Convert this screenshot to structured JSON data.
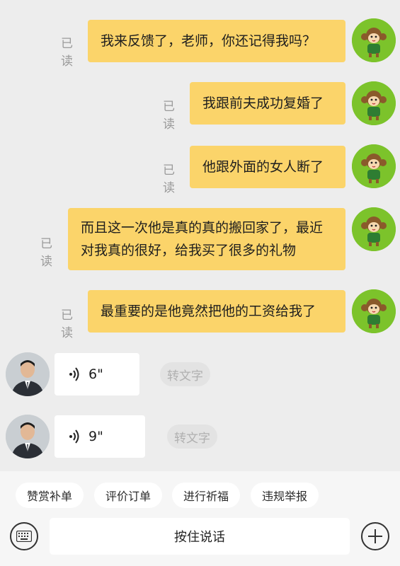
{
  "messages_out": [
    {
      "read": "已读",
      "text": "我来反馈了，老师，你还记得我吗？"
    },
    {
      "read": "已读",
      "text": "我跟前夫成功复婚了"
    },
    {
      "read": "已读",
      "text": "他跟外面的女人断了"
    },
    {
      "read": "已读",
      "text": "而且这一次他是真的真的搬回家了，最近对我真的很好，给我买了很多的礼物"
    },
    {
      "read": "已读",
      "text": "最重要的是他竟然把他的工资给我了"
    }
  ],
  "voice_messages": [
    {
      "duration": "6\"",
      "to_text": "转文字"
    },
    {
      "duration": "9\"",
      "to_text": "转文字"
    }
  ],
  "quick_actions": [
    "赞赏补单",
    "评价订单",
    "进行祈福",
    "违规举报"
  ],
  "input": {
    "hold_to_talk": "按住说话"
  },
  "icons": {
    "keyboard": "keyboard-icon",
    "plus": "plus-icon",
    "voice": "voice-wave-icon",
    "monkey_avatar": "monkey-avatar",
    "man_avatar": "man-avatar"
  },
  "colors": {
    "background": "#ededed",
    "bubble_out": "#fbd46a",
    "avatar_green": "#7cc32b"
  }
}
